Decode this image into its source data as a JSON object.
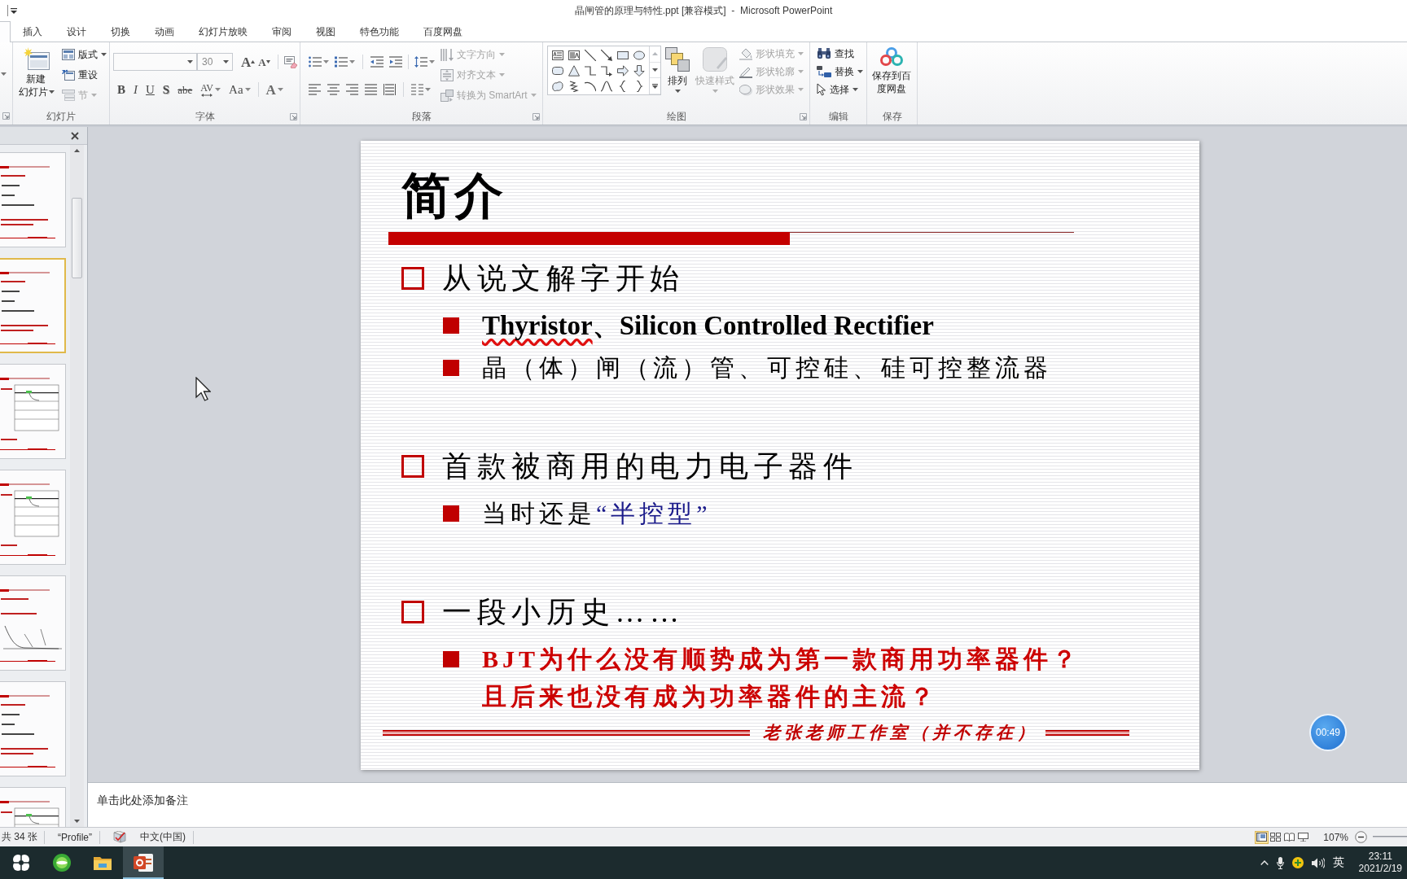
{
  "window": {
    "title": "晶闸管的原理与特性.ppt [兼容模式]  -  Microsoft PowerPoint"
  },
  "ribbon": {
    "tabs": [
      {
        "selected": true
      },
      {
        "label": "插入",
        "selected": false
      },
      {
        "label": "设计",
        "selected": false
      },
      {
        "label": "切换",
        "selected": false
      },
      {
        "label": "动画",
        "selected": false
      },
      {
        "label": "幻灯片放映",
        "selected": false
      },
      {
        "label": "审阅",
        "selected": false
      },
      {
        "label": "视图",
        "selected": false
      },
      {
        "label": "特色功能",
        "selected": false
      },
      {
        "label": "百度网盘",
        "selected": false
      }
    ],
    "slides_group": {
      "label": "幻灯片",
      "new_slide": {
        "label": "新建幻灯片",
        "disabled": false
      },
      "buttons": [
        {
          "kind": "layout",
          "label": "版式",
          "dropdown": true,
          "disabled": false
        },
        {
          "kind": "reset",
          "label": "重设",
          "dropdown": false,
          "disabled": false
        },
        {
          "kind": "section",
          "label": "节",
          "dropdown": true,
          "disabled": true
        }
      ]
    },
    "font_group": {
      "label": "字体",
      "font_size": "30",
      "size_buttons": [
        {
          "kind": "grow",
          "glyph": "A"
        },
        {
          "kind": "shrink",
          "glyph": "A"
        }
      ],
      "format_buttons": [
        {
          "kind": "bold",
          "glyph": "B"
        },
        {
          "kind": "italic",
          "glyph": "I"
        },
        {
          "kind": "underline",
          "glyph": "U"
        },
        {
          "kind": "shadow",
          "glyph": "S"
        },
        {
          "kind": "strike",
          "glyph": "abe"
        },
        {
          "kind": "spacing",
          "glyph": "AV"
        },
        {
          "kind": "case",
          "glyph": "Aa"
        },
        {
          "kind": "color",
          "glyph": "A"
        }
      ]
    },
    "paragraph_group": {
      "label": "段落",
      "text_buttons": [
        {
          "kind": "direction",
          "label": "文字方向",
          "disabled": true
        },
        {
          "kind": "align_text",
          "label": "对齐文本",
          "disabled": true
        },
        {
          "kind": "smartart",
          "label": "转换为 SmartArt",
          "disabled": true
        }
      ]
    },
    "drawing_group": {
      "label": "绘图",
      "arrange": {
        "label": "排列",
        "disabled": false
      },
      "quick_styles": {
        "label": "快速样式",
        "disabled": true
      },
      "shape_buttons": [
        {
          "kind": "fill",
          "label": "形状填充",
          "disabled": true
        },
        {
          "kind": "outline",
          "label": "形状轮廓",
          "disabled": true
        },
        {
          "kind": "effects",
          "label": "形状效果",
          "disabled": true
        }
      ]
    },
    "editing_group": {
      "label": "编辑",
      "buttons": [
        {
          "kind": "find",
          "label": "查找",
          "dropdown": false
        },
        {
          "kind": "replace",
          "label": "替换",
          "dropdown": true
        },
        {
          "kind": "select",
          "label": "选择",
          "dropdown": true
        }
      ]
    },
    "save_group": {
      "label": "保存",
      "save_button": {
        "label": "保存到百度网盘"
      }
    }
  },
  "slide_panel": {
    "thumbnails": [
      {
        "kind": "text",
        "selected": false
      },
      {
        "kind": "text",
        "selected": true
      },
      {
        "kind": "diagram",
        "selected": false
      },
      {
        "kind": "diagram",
        "selected": false
      },
      {
        "kind": "graph",
        "selected": false
      },
      {
        "kind": "text",
        "selected": false
      },
      {
        "kind": "diagram",
        "selected": false
      }
    ]
  },
  "slide": {
    "title": "简介",
    "sections": [
      {
        "text": "从说文解字开始",
        "subitems": [
          {
            "kind": "english",
            "runs": [
              {
                "kind": "misspelled",
                "text": "Thyristor"
              },
              {
                "kind": "plain",
                "text": "、Silicon Controlled Rectifier"
              }
            ]
          },
          {
            "kind": "chinese",
            "runs": [
              {
                "kind": "plain",
                "text": "晶（体）闸（流）管、可控硅、硅可控整流器"
              }
            ]
          }
        ]
      },
      {
        "text": "首款被商用的电力电子器件",
        "subitems": [
          {
            "kind": "chinese",
            "runs": [
              {
                "kind": "plain",
                "text": "当时还是"
              },
              {
                "kind": "quoted",
                "text": "“半控型”"
              }
            ]
          }
        ]
      },
      {
        "text": "一段小历史……",
        "subitems": [
          {
            "kind": "question",
            "runs": [
              {
                "kind": "plain",
                "text": "BJT为什么没有顺势成为第一款商用功率器件？且后来也没有成为功率器件的主流？"
              }
            ]
          }
        ]
      }
    ],
    "footer": "老张老师工作室（并不存在）"
  },
  "notes": {
    "placeholder": "单击此处添加备注"
  },
  "status_bar": {
    "slide_count": "共 34 张",
    "theme": "“Profile”",
    "language": "中文(中国)",
    "views": [
      {
        "kind": "normal",
        "selected": true
      },
      {
        "kind": "sorter",
        "selected": false
      },
      {
        "kind": "reading",
        "selected": false
      },
      {
        "kind": "slideshow",
        "selected": false
      }
    ],
    "zoom": "107%"
  },
  "taskbar": {
    "apps": [
      {
        "kind": "launcher",
        "active": false
      },
      {
        "kind": "browser",
        "active": false
      },
      {
        "kind": "folder",
        "active": false
      },
      {
        "kind": "presentation",
        "active": true
      }
    ],
    "input_method": "英",
    "time": "23:11",
    "date": "2021/2/19"
  },
  "recorder_timer": {
    "time": "00:49"
  }
}
